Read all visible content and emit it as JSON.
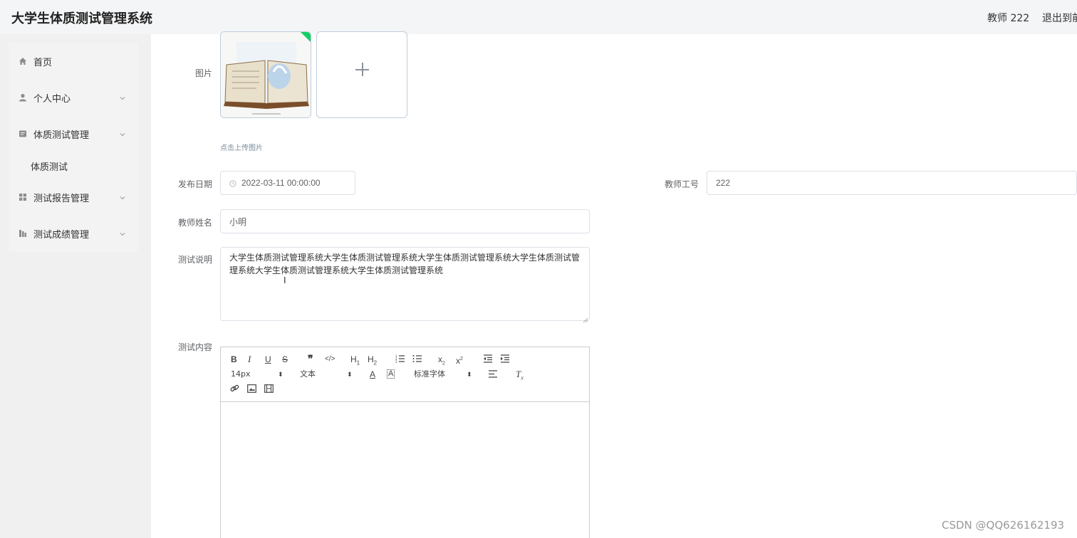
{
  "header": {
    "title": "大学生体质测试管理系统",
    "user": "教师 222",
    "logout": "退出到前台"
  },
  "sidebar": {
    "items": [
      {
        "label": "首页",
        "icon": "home-icon"
      },
      {
        "label": "个人中心",
        "icon": "user-icon"
      },
      {
        "label": "体质测试管理",
        "icon": "tickets-icon"
      },
      {
        "label": "测试报告管理",
        "icon": "grid-icon"
      },
      {
        "label": "测试成绩管理",
        "icon": "chart-icon"
      }
    ],
    "subitem": "体质测试"
  },
  "form": {
    "image_label": "图片",
    "upload_tip": "点击上传图片",
    "date_label": "发布日期",
    "date_value": "2022-03-11 00:00:00",
    "teacher_id_label": "教师工号",
    "teacher_id_value": "222",
    "teacher_name_label": "教师姓名",
    "teacher_name_value": "小明",
    "desc_label": "测试说明",
    "desc_value": "大学生体质测试管理系统大学生体质测试管理系统大学生体质测试管理系统大学生体质测试管理系统大学生体质测试管理系统大学生体质测试管理系统",
    "content_label": "测试内容"
  },
  "editor": {
    "size_option": "14px",
    "header_option": "文本",
    "font_option": "标准字体"
  },
  "watermark": "CSDN @QQ626162193"
}
